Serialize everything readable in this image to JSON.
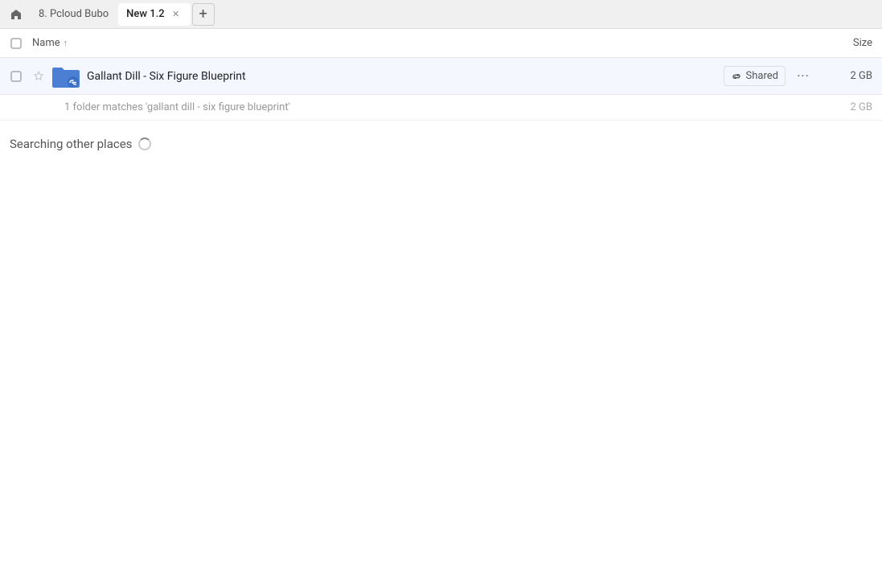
{
  "tabs": {
    "home_label": "🏠",
    "tab1_label": "8. Pcloud Bubo",
    "tab2_label": "New 1.2",
    "add_tab_label": "+"
  },
  "columns": {
    "name_label": "Name",
    "sort_indicator": "↑",
    "size_label": "Size"
  },
  "file_row": {
    "file_name": "Gallant Dill - Six Figure Blueprint",
    "shared_label": "Shared",
    "file_size": "2 GB"
  },
  "match_row": {
    "match_text": "1 folder matches 'gallant dill - six figure blueprint'",
    "match_size": "2 GB"
  },
  "searching": {
    "text": "Searching other places"
  }
}
